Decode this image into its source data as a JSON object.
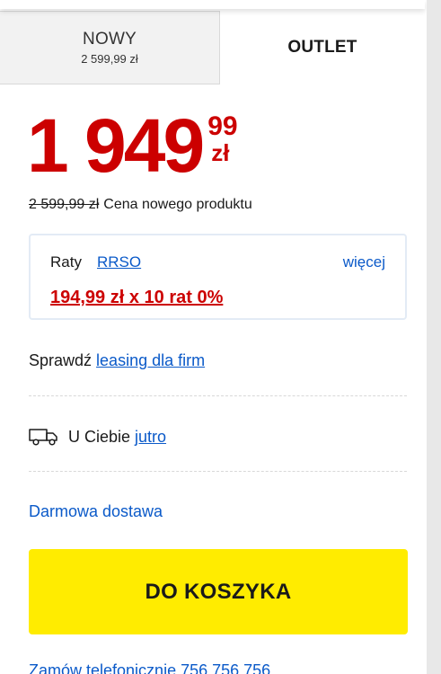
{
  "tabs": {
    "new": {
      "title": "NOWY",
      "price": "2 599,99 zł"
    },
    "outlet": {
      "title": "OUTLET"
    }
  },
  "price": {
    "integer": "1 949",
    "decimal": "99",
    "currency": "zł",
    "old_price": "2 599,99 zł",
    "old_price_label": "Cena nowego produktu"
  },
  "installments": {
    "label": "Raty",
    "rrso_link": "RRSO",
    "more_link": "więcej",
    "offer": "194,99 zł x 10 rat 0%"
  },
  "leasing": {
    "prefix": "Sprawdź",
    "link": "leasing dla firm"
  },
  "delivery": {
    "icon": "truck-icon",
    "prefix": "U Ciebie",
    "link": "jutro"
  },
  "free_shipping": "Darmowa dostawa",
  "cart_button": "DO KOSZYKA",
  "phone_order": "Zamów telefonicznie 756 756 756",
  "colors": {
    "price_red": "#cc0000",
    "link_blue": "#0b5ac9",
    "cart_yellow": "#ffec00"
  }
}
